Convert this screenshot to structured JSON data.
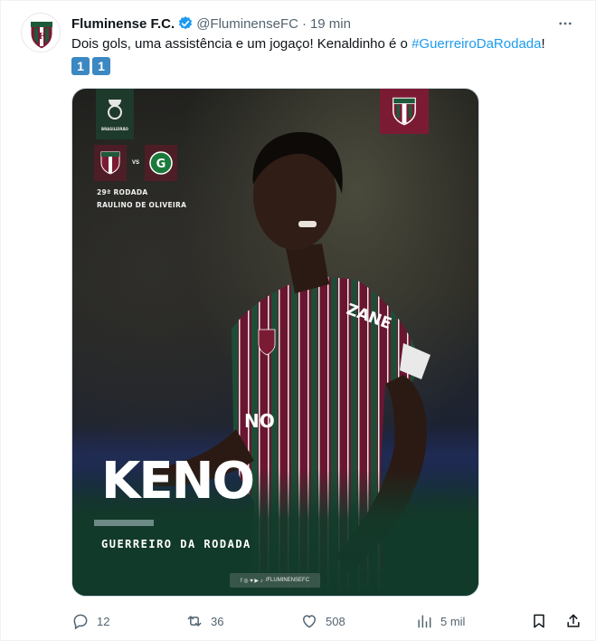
{
  "author": {
    "name": "Fluminense F.C.",
    "handle": "@FluminenseFC",
    "separator": "·",
    "time": "19 min"
  },
  "tweet": {
    "text_before": "Dois gols, uma assistência e um jogaço! Kenaldinho é o ",
    "hashtag": "#GuerreiroDaRodada",
    "text_after": "!",
    "emoji": [
      "1",
      "1"
    ]
  },
  "media": {
    "round": "29ª RODADA",
    "venue": "RAULINO DE OLIVEIRA",
    "vs": "VS",
    "player_name": "KENO",
    "subtitle": "GUERREIRO DA RODADA",
    "social_handle": "/FLUMINENSEFC",
    "jersey_text": "ZANE",
    "number_text": "NO",
    "league_badge_text": "BRASILEIRÃO"
  },
  "actions": {
    "replies": "12",
    "retweets": "36",
    "likes": "508",
    "views": "5 mil"
  },
  "colors": {
    "link": "#1d9bf0",
    "muted": "#536471",
    "club_grena": "#7b1b33",
    "club_green": "#1e5a3a",
    "verified": "#1d9bf0"
  }
}
